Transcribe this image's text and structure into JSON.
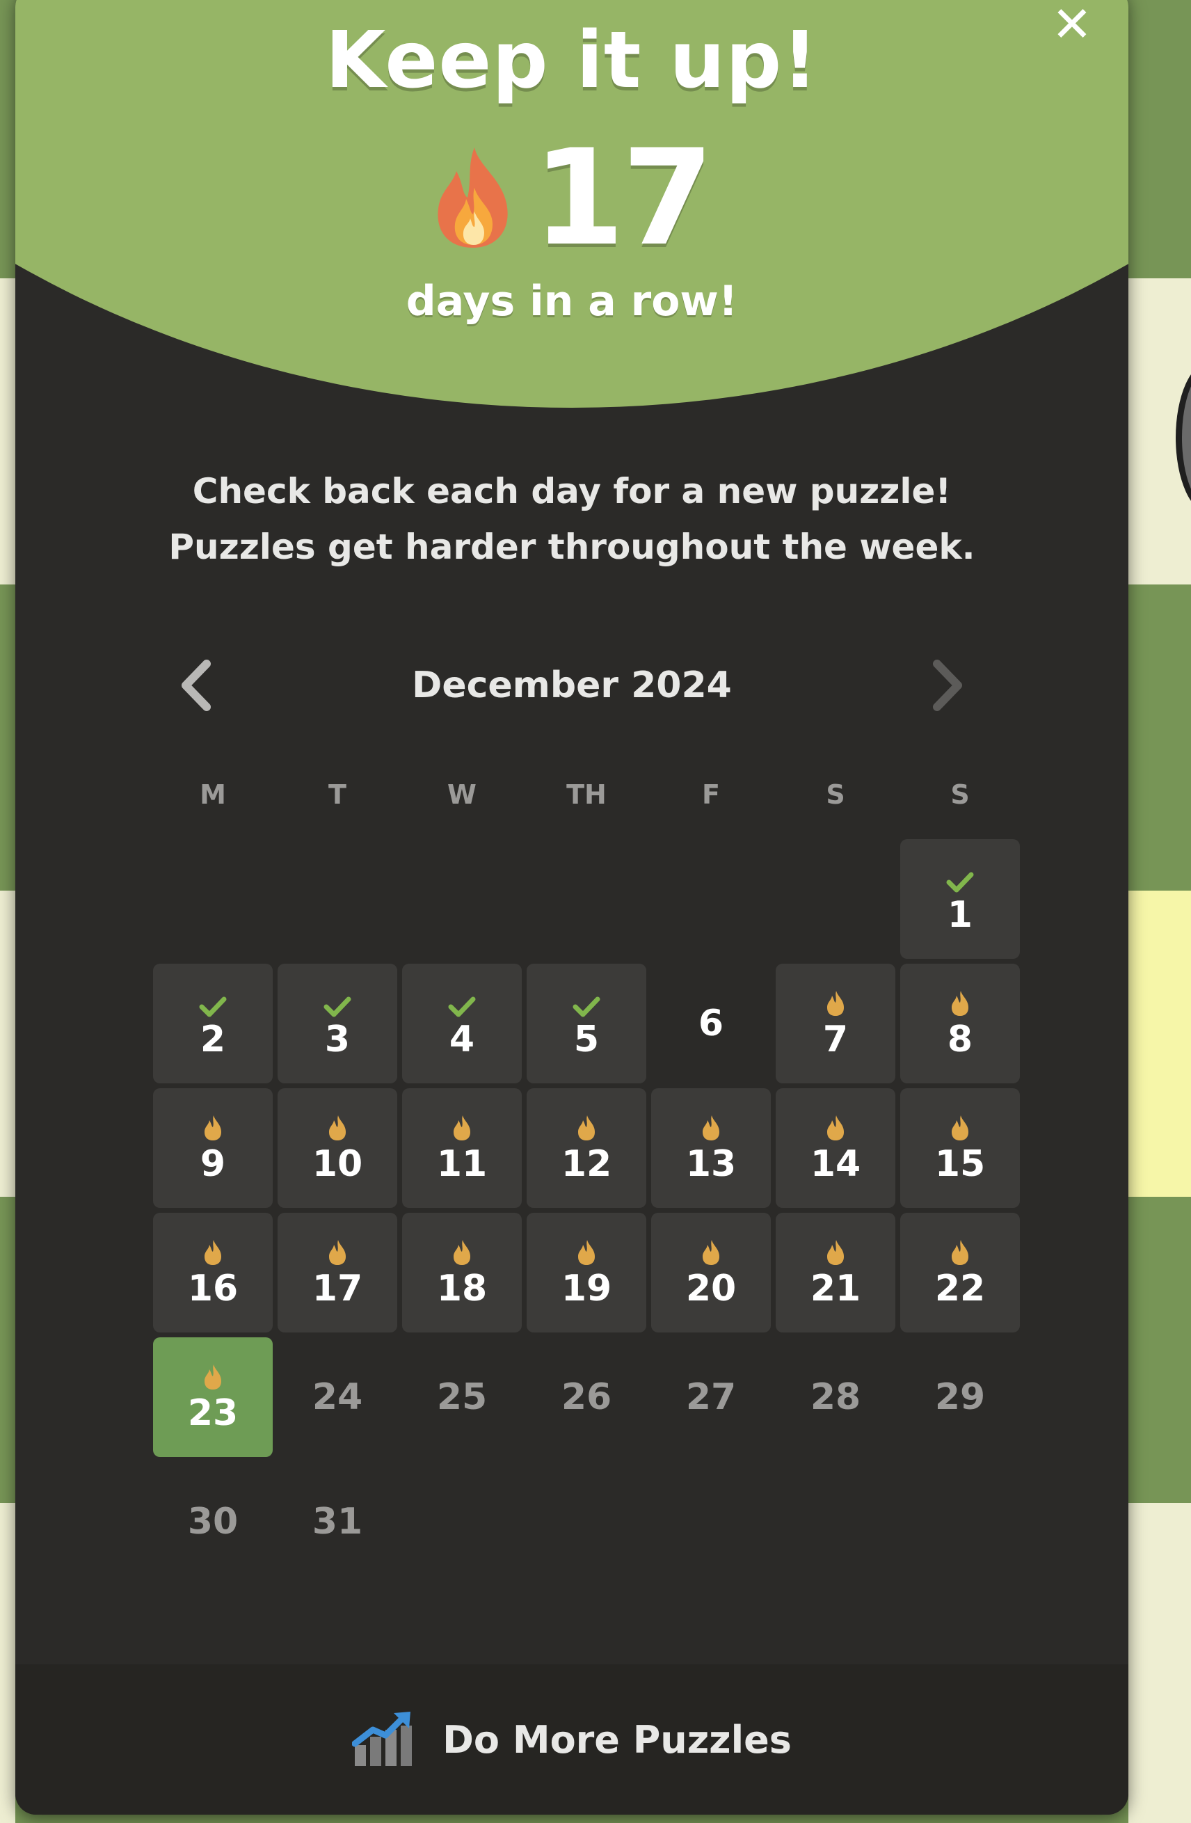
{
  "modal": {
    "title": "Keep it up!",
    "streak_count": "17",
    "streak_label": "days in a row!",
    "description_line1": "Check back each day for a new puzzle!",
    "description_line2": "Puzzles get harder throughout the week.",
    "close_icon": "close-icon"
  },
  "calendar": {
    "month_label": "December 2024",
    "prev_icon": "chevron-left-icon",
    "next_icon": "chevron-right-icon",
    "weekdays": [
      "M",
      "T",
      "W",
      "TH",
      "F",
      "S",
      "S"
    ],
    "days": [
      {
        "label": "1",
        "status": "solved"
      },
      {
        "label": "2",
        "status": "solved"
      },
      {
        "label": "3",
        "status": "solved"
      },
      {
        "label": "4",
        "status": "solved"
      },
      {
        "label": "5",
        "status": "solved"
      },
      {
        "label": "6",
        "status": "missed"
      },
      {
        "label": "7",
        "status": "streak"
      },
      {
        "label": "8",
        "status": "streak"
      },
      {
        "label": "9",
        "status": "streak"
      },
      {
        "label": "10",
        "status": "streak"
      },
      {
        "label": "11",
        "status": "streak"
      },
      {
        "label": "12",
        "status": "streak"
      },
      {
        "label": "13",
        "status": "streak"
      },
      {
        "label": "14",
        "status": "streak"
      },
      {
        "label": "15",
        "status": "streak"
      },
      {
        "label": "16",
        "status": "streak"
      },
      {
        "label": "17",
        "status": "streak"
      },
      {
        "label": "18",
        "status": "streak"
      },
      {
        "label": "19",
        "status": "streak"
      },
      {
        "label": "20",
        "status": "streak"
      },
      {
        "label": "21",
        "status": "streak"
      },
      {
        "label": "22",
        "status": "streak"
      },
      {
        "label": "23",
        "status": "today"
      },
      {
        "label": "24",
        "status": "future"
      },
      {
        "label": "25",
        "status": "future"
      },
      {
        "label": "26",
        "status": "future"
      },
      {
        "label": "27",
        "status": "future"
      },
      {
        "label": "28",
        "status": "future"
      },
      {
        "label": "29",
        "status": "future"
      },
      {
        "label": "30",
        "status": "future"
      },
      {
        "label": "31",
        "status": "future"
      }
    ]
  },
  "footer": {
    "button_label": "Do More Puzzles",
    "icon": "chart-trending-up-icon"
  },
  "colors": {
    "hero_green": "#96b566",
    "modal_bg": "#2b2a28",
    "cell_bg": "#3c3b39",
    "today_green": "#6e9c55",
    "check_green": "#81b64c",
    "flame_gold": "#e0a84a"
  }
}
